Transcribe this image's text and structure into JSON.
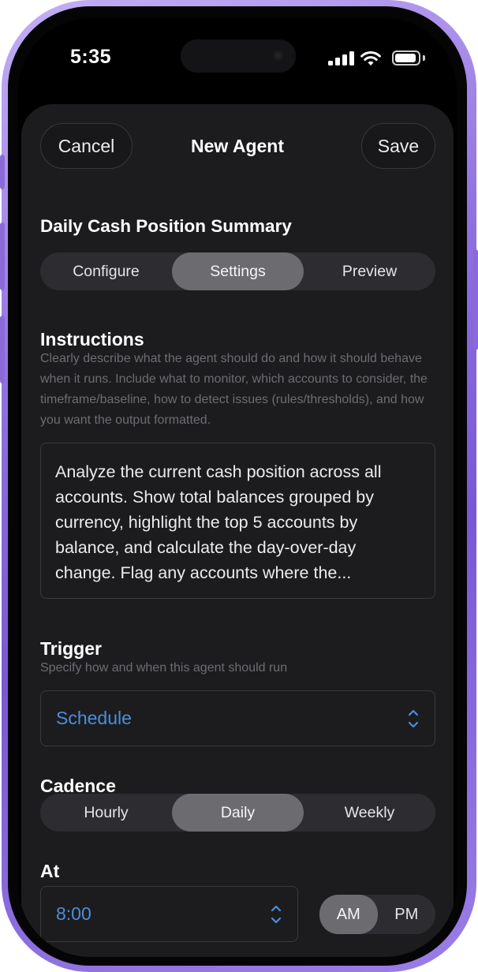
{
  "status_bar": {
    "time": "5:35",
    "icons": [
      "signal-icon",
      "wifi-icon",
      "battery-icon"
    ]
  },
  "header": {
    "cancel_label": "Cancel",
    "title": "New Agent",
    "save_label": "Save"
  },
  "agent": {
    "name": "Daily Cash Position Summary"
  },
  "tabs": {
    "items": [
      {
        "label": "Configure",
        "active": false
      },
      {
        "label": "Settings",
        "active": true
      },
      {
        "label": "Preview",
        "active": false
      }
    ]
  },
  "instructions": {
    "title": "Instructions",
    "help": "Clearly describe what the agent should do and how it should behave when it runs. Include what to monitor, which accounts to consider, the timeframe/baseline, how to detect issues (rules/thresholds), and how you want the output formatted.",
    "value": "Analyze the current cash position across all accounts. Show total balances grouped by currency, highlight the top 5 accounts by balance, and calculate the day-over-day change. Flag any accounts where the..."
  },
  "trigger": {
    "title": "Trigger",
    "help": "Specify how and when this agent should run",
    "selected": "Schedule"
  },
  "cadence": {
    "title": "Cadence",
    "options": [
      {
        "label": "Hourly",
        "active": false
      },
      {
        "label": "Daily",
        "active": true
      },
      {
        "label": "Weekly",
        "active": false
      }
    ]
  },
  "at": {
    "title": "At",
    "time": "8:00",
    "meridiem": [
      {
        "label": "AM",
        "active": true
      },
      {
        "label": "PM",
        "active": false
      }
    ]
  },
  "colors": {
    "frame": "#8f6fe0",
    "sheet": "#1c1c1f",
    "accent_blue": "#4b8fd8",
    "segment_active": "#6b6b70",
    "segment_track": "#2d2d31"
  }
}
